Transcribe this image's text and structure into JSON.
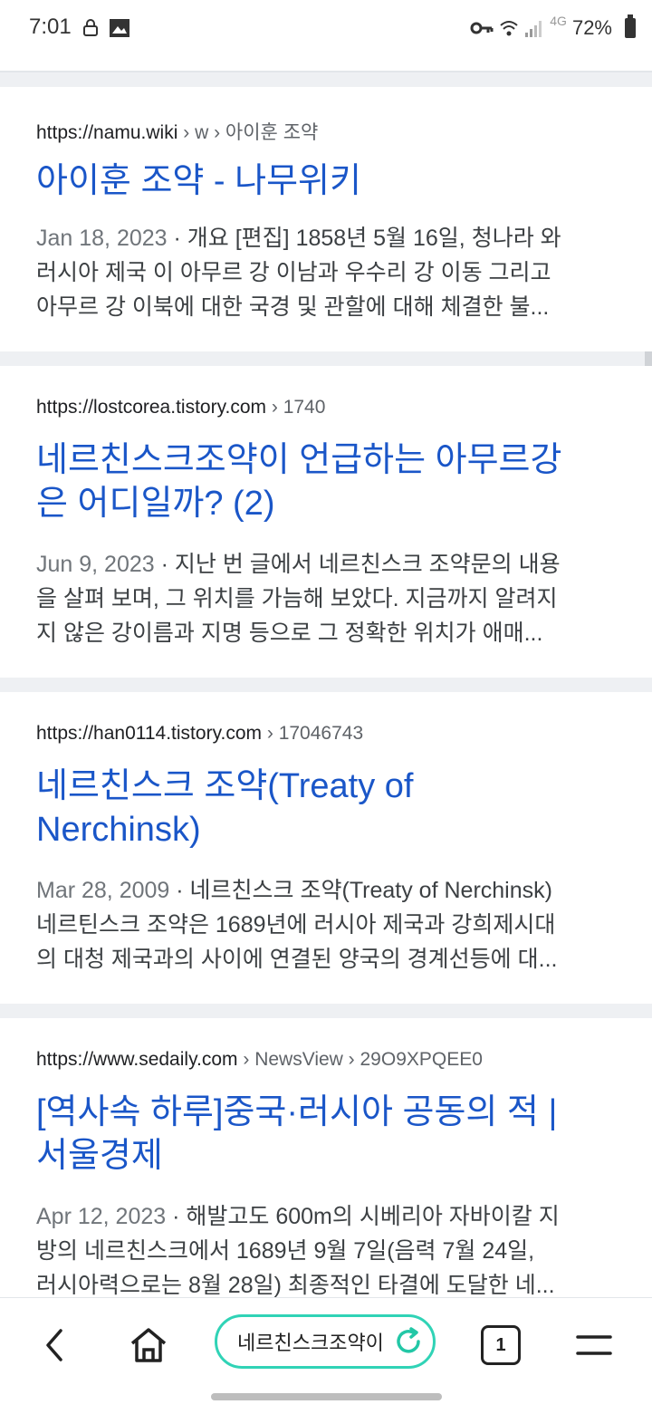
{
  "status_bar": {
    "time": "7:01",
    "network": "4G",
    "battery": "72%"
  },
  "results": [
    {
      "url_domain": "https://namu.wiki",
      "url_path": " › w › 아이훈 조약",
      "title_line1": "아이훈 조약 - 나무위키",
      "title_line2": "",
      "date": "Jan 18, 2023",
      "snippet_line1": " · 개요 [편집] 1858년 5월 16일, 청나라 와",
      "snippet_line2": "러시아 제국 이 아무르 강 이남과 우수리 강 이동 그리고",
      "snippet_line3": "아무르 강 이북에 대한 국경 및 관할에 대해 체결한 불..."
    },
    {
      "url_domain": "https://lostcorea.tistory.com",
      "url_path": " › 1740",
      "title_line1": "네르친스크조약이 언급하는 아무르강",
      "title_line2": "은 어디일까? (2)",
      "date": "Jun 9, 2023",
      "snippet_line1": " · 지난 번 글에서 네르친스크 조약문의 내용",
      "snippet_line2": "을 살펴 보며, 그 위치를 가늠해 보았다. 지금까지 알려지",
      "snippet_line3": "지 않은 강이름과 지명 등으로 그 정확한 위치가 애매..."
    },
    {
      "url_domain": "https://han0114.tistory.com",
      "url_path": " › 17046743",
      "title_line1": "네르친스크 조약(Treaty of",
      "title_line2": "Nerchinsk)",
      "date": "Mar 28, 2009",
      "snippet_line1": " · 네르친스크 조약(Treaty of Nerchinsk)",
      "snippet_line2": "네르틴스크 조약은 1689년에 러시아 제국과 강희제시대",
      "snippet_line3": "의 대청 제국과의 사이에 연결된 양국의 경계선등에 대..."
    },
    {
      "url_domain": "https://www.sedaily.com",
      "url_path": " › NewsView › 29O9XPQEE0",
      "title_line1": "[역사속 하루]중국·러시아 공동의 적 |",
      "title_line2": "서울경제",
      "date": "Apr 12, 2023",
      "snippet_line1": " · 해발고도 600m의 시베리아 자바이칼 지",
      "snippet_line2": "방의 네르친스크에서 1689년 9월 7일(음력 7월 24일,",
      "snippet_line3": "러시아력으로는 8월 28일) 최종적인 타결에 도달한 네..."
    }
  ],
  "bottom_bar": {
    "address_text": "네르친스크조약이",
    "tab_count": "1"
  }
}
